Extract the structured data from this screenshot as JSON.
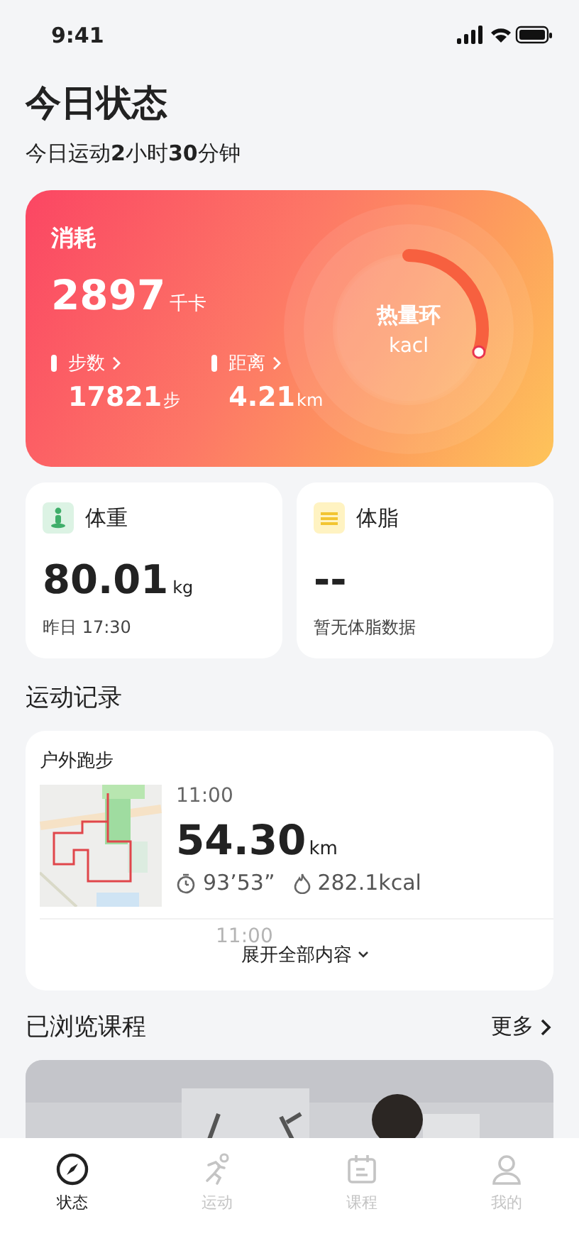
{
  "status_bar": {
    "time": "9:41"
  },
  "header": {
    "title": "今日状态",
    "subtitle": "今日运动**2**小时**30**分钟"
  },
  "calorie_card": {
    "label": "消耗",
    "value": "2897",
    "unit": "千卡",
    "ring": {
      "label": "热量环",
      "unit": "kacl",
      "level": 0.3
    },
    "stats": [
      {
        "label": "步数",
        "value": "17821",
        "unit": "步"
      },
      {
        "label": "距离",
        "value": "4.21",
        "unit": "km"
      }
    ]
  },
  "body_cards": [
    {
      "kind": "weight",
      "title": "体重",
      "value": "80.01",
      "unit": "kg",
      "note": "昨日 17:30"
    },
    {
      "kind": "fat",
      "title": "体脂",
      "value": "--",
      "note": "暂无体脂数据"
    }
  ],
  "records": {
    "title": "运动记录",
    "type": "户外跑步",
    "entry": {
      "time": "11:00",
      "distance": "54.30",
      "unit": "km",
      "duration": "93’53”",
      "calories": "282.1kcal"
    },
    "faded_time": "11:00",
    "expand": "展开全部内容"
  },
  "courses": {
    "title": "已浏览课程",
    "more": "更多"
  },
  "tabs": [
    {
      "kind": "compass",
      "label": "状态",
      "selected": true
    },
    {
      "kind": "run",
      "label": "运动",
      "selected": false
    },
    {
      "kind": "calendar",
      "label": "课程",
      "selected": false
    },
    {
      "kind": "person",
      "label": "我的",
      "selected": false
    }
  ]
}
